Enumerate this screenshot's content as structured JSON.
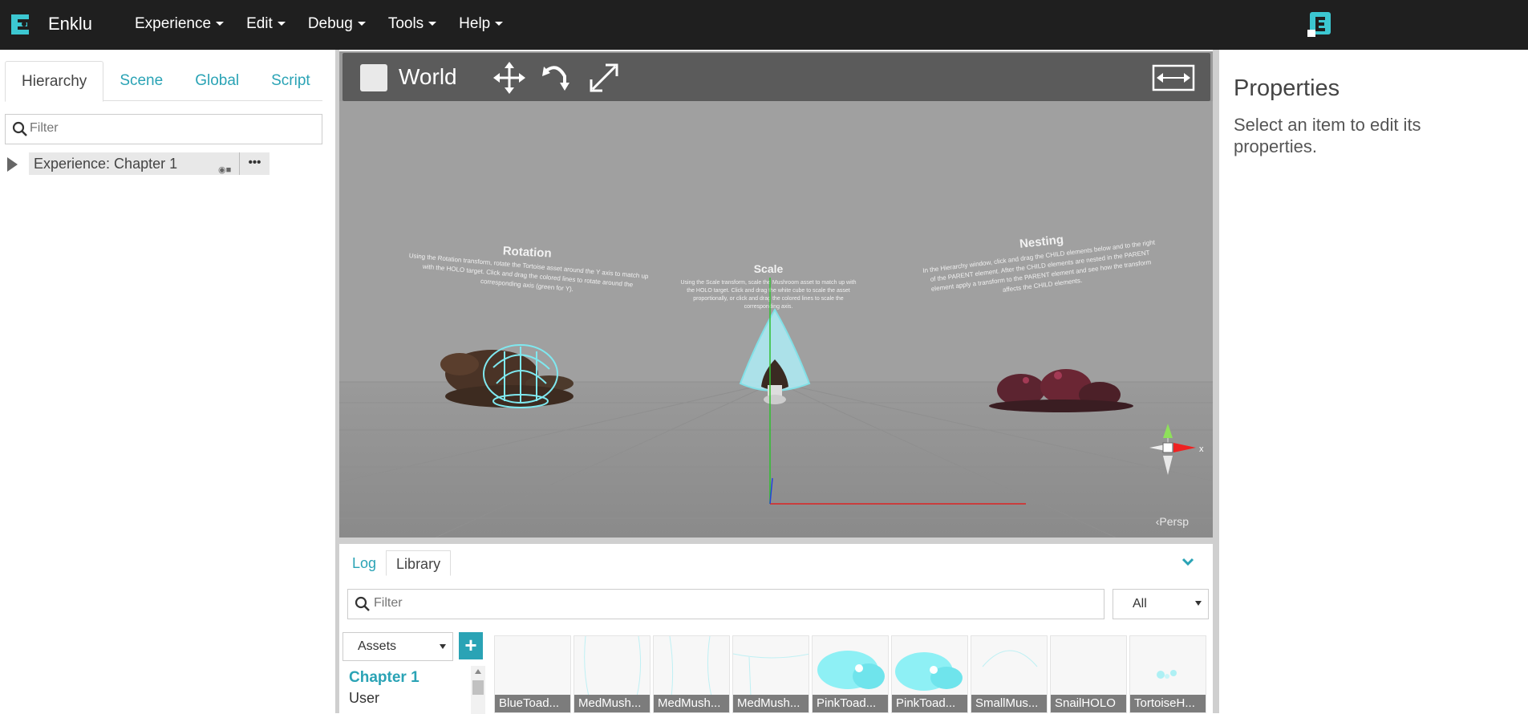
{
  "app": {
    "name": "Enklu"
  },
  "menu": [
    {
      "label": "Experience"
    },
    {
      "label": "Edit"
    },
    {
      "label": "Debug"
    },
    {
      "label": "Tools"
    },
    {
      "label": "Help"
    }
  ],
  "left": {
    "tabs": [
      {
        "label": "Hierarchy",
        "active": true
      },
      {
        "label": "Scene"
      },
      {
        "label": "Global"
      },
      {
        "label": "Script"
      }
    ],
    "filter_placeholder": "Filter",
    "tree": {
      "label": "Experience: Chapter 1"
    }
  },
  "viewport": {
    "world_label": "World",
    "persp_label": "Persp",
    "signs": [
      {
        "title": "Rotation",
        "body": "Using the Rotation transform, rotate the Tortoise asset around the Y axis to match up with the HOLO target. Click and drag the colored lines to rotate around the corresponding axis (green for Y)."
      },
      {
        "title": "Scale",
        "body": "Using the Scale transform, scale the Mushroom asset to match up with the HOLO target. Click and drag the white cube to scale the asset proportionally, or click and drag the colored lines to scale the corresponding axis."
      },
      {
        "title": "Nesting",
        "body": "In the Hierarchy window, click and drag the CHILD elements below and to the right of the PARENT element. After the CHILD elements are nested in the PARENT element apply a transform to the PARENT element and see how the transform affects the CHILD elements."
      }
    ]
  },
  "properties": {
    "title": "Properties",
    "hint": "Select an item to edit its properties."
  },
  "bottom": {
    "tabs": [
      {
        "label": "Log"
      },
      {
        "label": "Library",
        "active": true
      }
    ],
    "filter_placeholder": "Filter",
    "type_select": "All",
    "assets_select": "Assets",
    "add_label": "+",
    "folders": [
      "Chapter 1",
      "User"
    ],
    "assets": [
      {
        "label": "BlueToad..."
      },
      {
        "label": "MedMush..."
      },
      {
        "label": "MedMush..."
      },
      {
        "label": "MedMush..."
      },
      {
        "label": "PinkToad..."
      },
      {
        "label": "PinkToad..."
      },
      {
        "label": "SmallMus..."
      },
      {
        "label": "SnailHOLO"
      },
      {
        "label": "TortoiseH..."
      }
    ]
  },
  "colors": {
    "accent": "#2aa3b5",
    "topbar": "#1f1f1f",
    "viewport_bg": "#999999",
    "holo": "#7fe8ef"
  }
}
